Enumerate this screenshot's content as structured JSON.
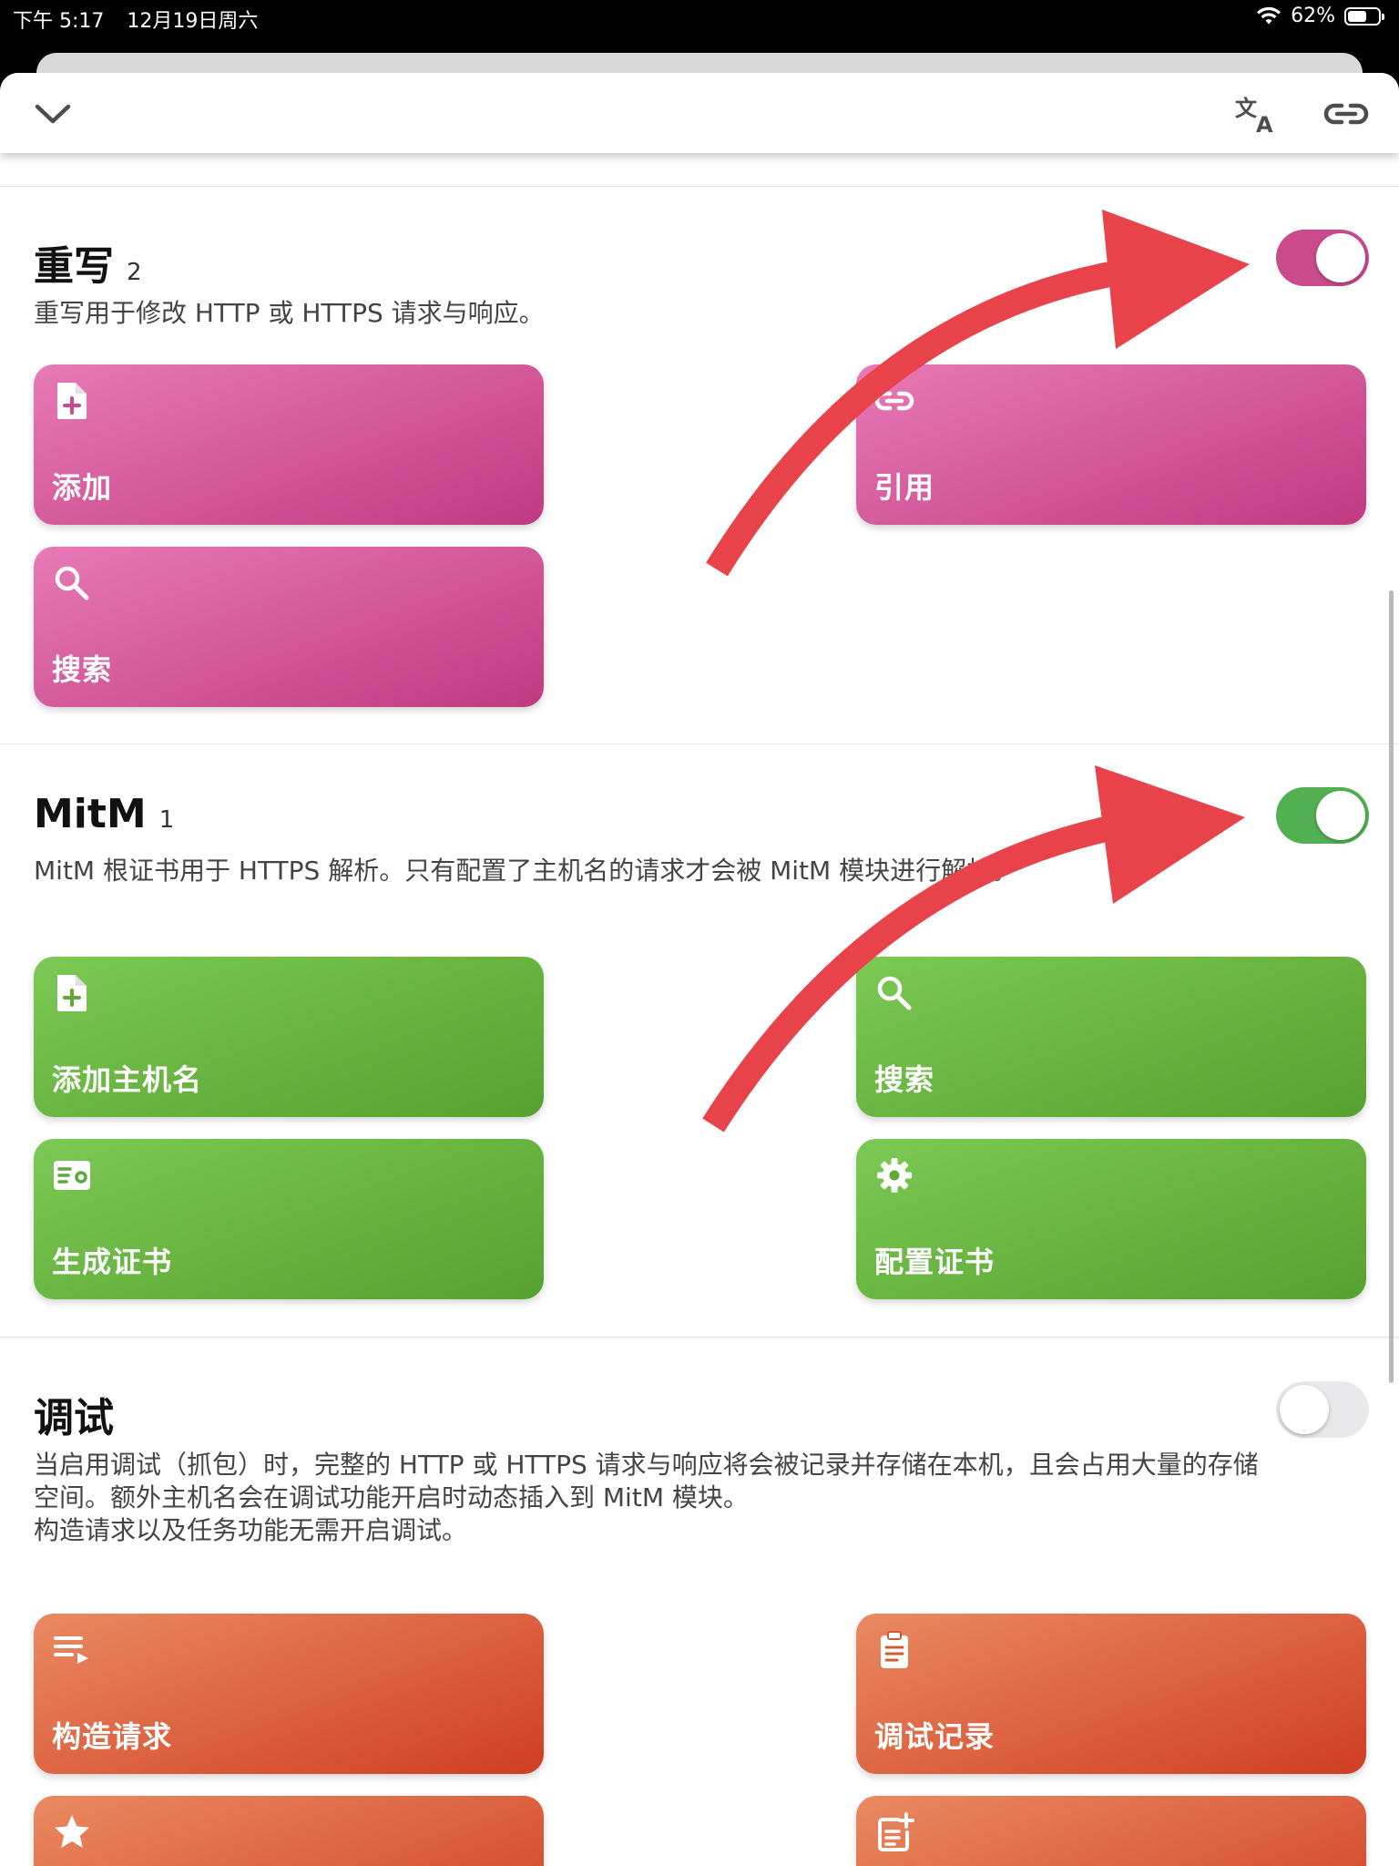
{
  "status_bar": {
    "time": "下午 5:17",
    "date": "12月19日周六",
    "battery_percent": "62%",
    "battery_level": 0.62
  },
  "nav": {
    "collapse_icon": "chevron-down-icon",
    "translate_icon": "translate-icon",
    "link_icon": "link-icon"
  },
  "rewrite": {
    "title": "重写",
    "count": "2",
    "description": "重写用于修改 HTTP 或 HTTPS 请求与响应。",
    "enabled": true,
    "toggle_color": "#c94a8d",
    "buttons": [
      {
        "label": "添加",
        "icon": "file-add-icon"
      },
      {
        "label": "引用",
        "icon": "link-icon"
      },
      {
        "label": "搜索",
        "icon": "search-icon"
      }
    ]
  },
  "mitm": {
    "title": "MitM",
    "count": "1",
    "description": "MitM 根证书用于 HTTPS 解析。只有配置了主机名的请求才会被 MitM 模块进行解析。",
    "enabled": true,
    "toggle_color": "#53b052",
    "buttons": [
      {
        "label": "添加主机名",
        "icon": "file-add-icon"
      },
      {
        "label": "搜索",
        "icon": "search-icon"
      },
      {
        "label": "生成证书",
        "icon": "certificate-icon"
      },
      {
        "label": "配置证书",
        "icon": "gear-icon"
      }
    ]
  },
  "debug": {
    "title": "调试",
    "description_lines": [
      "当启用调试（抓包）时，完整的 HTTP 或 HTTPS 请求与响应将会被记录并存储在本机，且会占用大量的存储",
      "空间。额外主机名会在调试功能开启时动态插入到 MitM 模块。",
      "构造请求以及任务功能无需开启调试。"
    ],
    "enabled": false,
    "buttons": [
      {
        "label": "构造请求",
        "icon": "playlist-icon"
      },
      {
        "label": "调试记录",
        "icon": "clipboard-icon"
      },
      {
        "label": "",
        "icon": "star-icon"
      },
      {
        "label": "",
        "icon": "note-add-icon"
      }
    ]
  },
  "annotations": {
    "arrow_color": "#e8434a"
  }
}
